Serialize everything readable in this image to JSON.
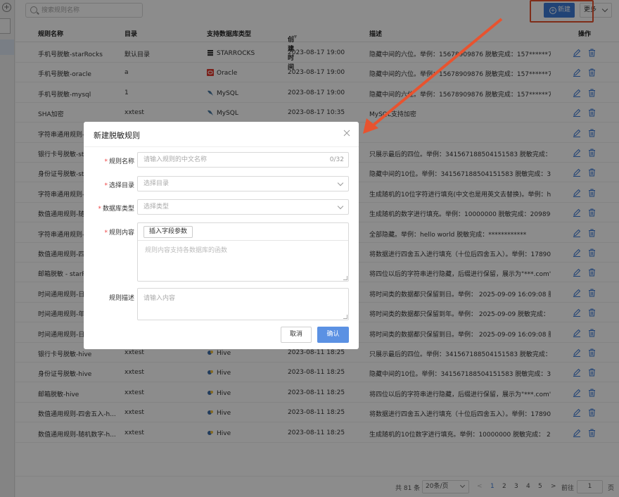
{
  "toolbar": {
    "search_placeholder": "搜索规则名称",
    "new_label": "新建",
    "more_label": "更多"
  },
  "table": {
    "headers": {
      "name": "规则名称",
      "dir": "目录",
      "db": "支持数据库类型",
      "time": "创建时间",
      "desc": "描述",
      "ops": "操作"
    },
    "rows": [
      {
        "name": "手机号脱敏-starRocks",
        "dir": "默认目录",
        "db": "STARROCKS",
        "db_icon": "starrocks-icon",
        "time": "2023-08-17 19:00",
        "desc": "隐藏中间的六位。举例：15678909876 脱敏完成：157******76"
      },
      {
        "name": "手机号脱敏-oracle",
        "dir": "a",
        "db": "Oracle",
        "db_icon": "oracle-icon",
        "time": "2023-08-17 19:00",
        "desc": "隐藏中间的六位。举例：15678909876 脱敏完成：157******76"
      },
      {
        "name": "手机号脱敏-mysql",
        "dir": "1",
        "db": "MySQL",
        "db_icon": "mysql-icon",
        "time": "2023-08-17 19:00",
        "desc": "隐藏中间的六位。举例：15678909876 脱敏完成：157******76"
      },
      {
        "name": "SHA加密",
        "dir": "xxtest",
        "db": "MySQL",
        "db_icon": "mysql-icon",
        "time": "2023-08-17 10:35",
        "desc": "MySQL支持加密"
      },
      {
        "name": "字符串通用规则-",
        "dir": "",
        "db": "",
        "db_icon": "",
        "time": "",
        "desc": ""
      },
      {
        "name": "银行卡号脱敏-sta",
        "dir": "",
        "db": "",
        "db_icon": "",
        "time": "",
        "desc": "只展示最后的四位。举例：341567188504151583 脱敏完成：****..."
      },
      {
        "name": "身份证号脱敏-sta",
        "dir": "",
        "db": "",
        "db_icon": "",
        "time": "",
        "desc": "隐藏中间的10位。举例：341567188504151583 脱敏完成：3415*..."
      },
      {
        "name": "字符串通用规则-",
        "dir": "",
        "db": "",
        "db_icon": "",
        "time": "",
        "desc": "生成随机的10位字符进行填充(中文也是用英文去替换)。举例：hell..."
      },
      {
        "name": "数值通用规则-随",
        "dir": "",
        "db": "",
        "db_icon": "",
        "time": "",
        "desc": "生成随机的数字进行填充。举例：10000000 脱敏完成：2098907..."
      },
      {
        "name": "字符串通用规则-",
        "dir": "",
        "db": "",
        "db_icon": "",
        "time": "",
        "desc": "全部隐藏。举例：hello world 脱敏完成：************"
      },
      {
        "name": "数值通用规则-四",
        "dir": "",
        "db": "",
        "db_icon": "",
        "time": "",
        "desc": "将数据进行四舍五入进行填充（十位后四舍五入）。举例：17890...."
      },
      {
        "name": "邮箱脱敏 - starR",
        "dir": "",
        "db": "",
        "db_icon": "",
        "time": "",
        "desc": "将四位以后的字符串进行隐藏，后缀进行保留，展示为\"***.com\"..."
      },
      {
        "name": "时间通用规则-日",
        "dir": "",
        "db": "",
        "db_icon": "",
        "time": "",
        "desc": "将时间类的数据都只保留到日。举例： 2025-09-09 16:09:08 脱..."
      },
      {
        "name": "时间通用规则-年",
        "dir": "",
        "db": "",
        "db_icon": "",
        "time": "",
        "desc": "将时间类的数据都只保留到年。举例： 2025-09-09 脱敏完成： 2..."
      },
      {
        "name": "时间通用规则-日",
        "dir": "",
        "db": "",
        "db_icon": "",
        "time": "",
        "desc": "将时间类的数据都只保留到日。举例： 2025-09-09 16:09:08 脱..."
      },
      {
        "name": "银行卡号脱敏-hive",
        "dir": "xxtest",
        "db": "Hive",
        "db_icon": "hive-icon",
        "time": "2023-08-11 18:25",
        "desc": "只展示最后的四位。举例：341567188504151583 脱敏完成：****..."
      },
      {
        "name": "身份证号脱敏-hive",
        "dir": "xxtest",
        "db": "Hive",
        "db_icon": "hive-icon",
        "time": "2023-08-11 18:25",
        "desc": "隐藏中间的10位。举例：341567188504151583 脱敏完成：3415*..."
      },
      {
        "name": "邮箱脱敏-hive",
        "dir": "xxtest",
        "db": "Hive",
        "db_icon": "hive-icon",
        "time": "2023-08-11 18:25",
        "desc": "将四位以后的字符串进行隐藏，后缀进行保留，展示为\"***.com\"..."
      },
      {
        "name": "数值通用规则-四舍五入-h...",
        "dir": "xxtest",
        "db": "Hive",
        "db_icon": "hive-icon",
        "time": "2023-08-11 18:25",
        "desc": "将数据进行四舍五入进行填充（十位后四舍五入）。举例：17890...."
      },
      {
        "name": "数值通用规则-随机数字-h...",
        "dir": "xxtest",
        "db": "Hive",
        "db_icon": "hive-icon",
        "time": "2023-08-11 18:25",
        "desc": "生成随机的10位数字进行填充。举例：10000000 脱敏完成： 209..."
      }
    ]
  },
  "pager": {
    "total": "共 81 条",
    "size": "20条/页",
    "prev": "<",
    "pages": [
      "1",
      "2",
      "3",
      "4",
      "5"
    ],
    "next": ">",
    "goto": "前往",
    "jump_value": "1",
    "page_unit": "页"
  },
  "modal": {
    "title": "新建脱敏规则",
    "fields": {
      "name_label": "规则名称",
      "name_placeholder": "请输入规则的中文名称",
      "name_count": "0/32",
      "dir_label": "选择目录",
      "dir_placeholder": "选择目录",
      "type_label": "数据库类型",
      "type_placeholder": "选择类型",
      "content_label": "规则内容",
      "insert_label": "插入字段参数",
      "content_placeholder": "规则内容支持各数据库的函数",
      "desc_label": "规则描述",
      "desc_placeholder": "请输入内容"
    },
    "cancel_label": "取消",
    "ok_label": "确认"
  },
  "colors": {
    "primary": "#3c7bd8",
    "highlight": "#e8532f",
    "arrow": "#e8532f"
  }
}
